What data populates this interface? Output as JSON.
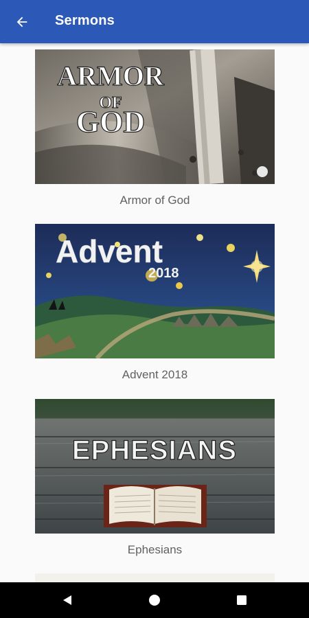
{
  "app_bar": {
    "title": "Sermons",
    "back_icon": "arrow-back-icon",
    "background": "#2c58b7"
  },
  "sermons": [
    {
      "title": "Armor of God",
      "artwork_text": [
        "ARMOR",
        "OF",
        "GOD"
      ]
    },
    {
      "title": "Advent 2018",
      "artwork_text": [
        "Advent",
        "2018"
      ]
    },
    {
      "title": "Ephesians",
      "artwork_text": [
        "EPHESIANS"
      ]
    }
  ],
  "nav_bar": {
    "back_icon": "triangle-back-icon",
    "home_icon": "circle-home-icon",
    "recents_icon": "square-recents-icon"
  }
}
